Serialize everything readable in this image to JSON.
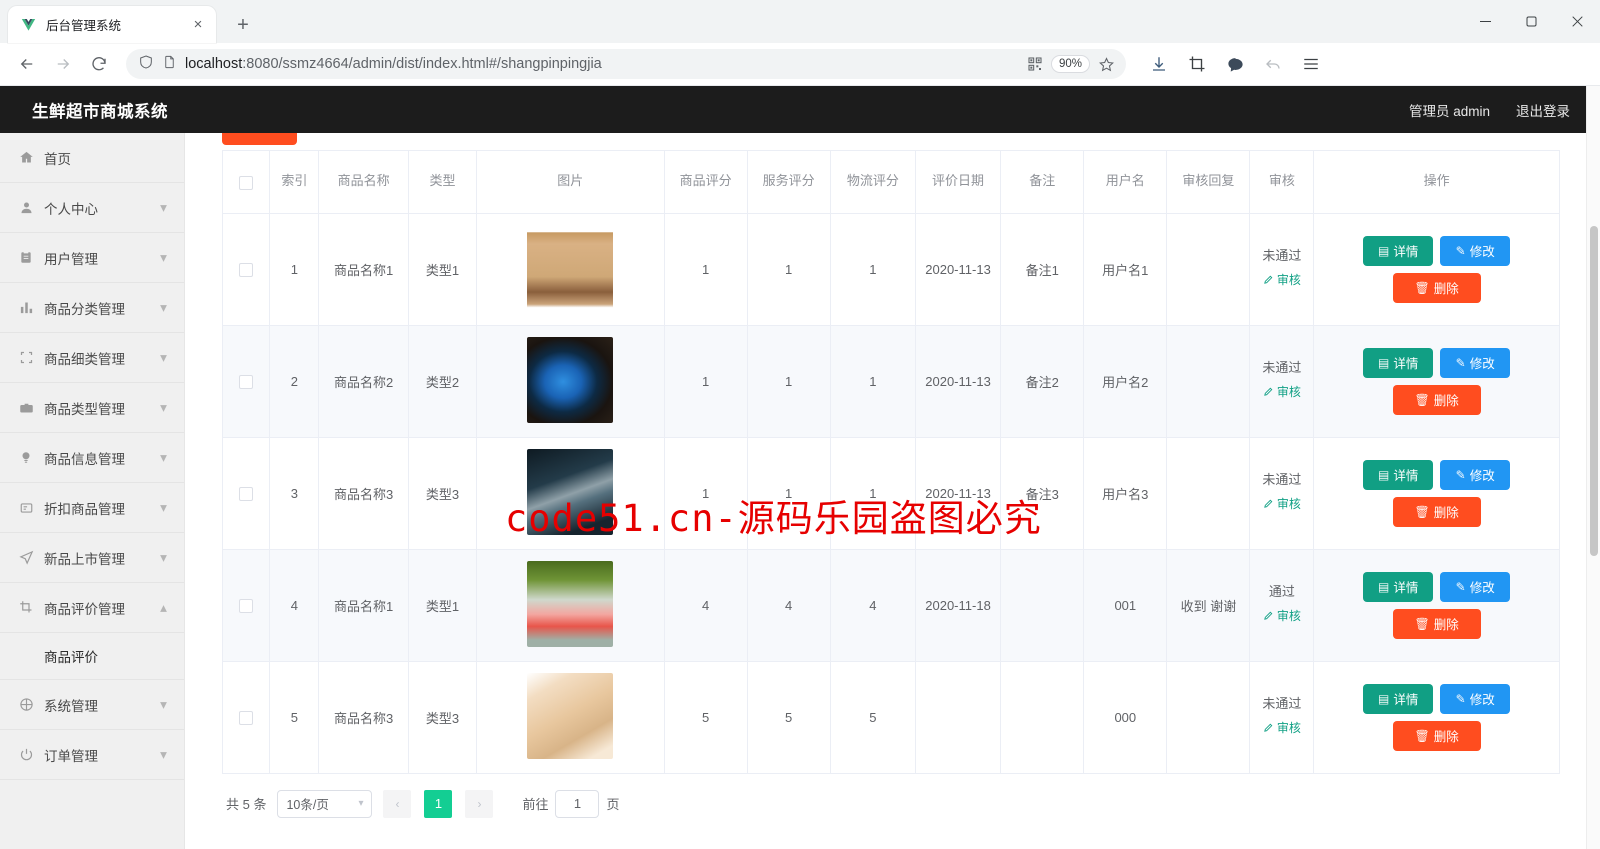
{
  "browser": {
    "tab": {
      "title": "后台管理系统",
      "favicon": "vue-logo-icon",
      "close": "×"
    },
    "new_tab": "+",
    "window_controls": {
      "minimize": "—",
      "maximize": "▢",
      "close": "✕"
    },
    "nav": {
      "back": "←",
      "forward": "→",
      "reload": "⟳"
    },
    "omnibox": {
      "shield_icon": "shield-icon",
      "page_icon": "page-icon",
      "url_host": "localhost",
      "url_rest": ":8080/ssmz4664/admin/dist/index.html#/shangpinpingjia",
      "qr_icon": "qr-code-icon",
      "zoom_level": "90%",
      "star_icon": "star-icon"
    },
    "toolbar_icons": [
      "download-icon",
      "screenshot-icon",
      "comment-icon",
      "undo-icon",
      "menu-icon"
    ]
  },
  "app": {
    "title": "生鲜超市商城系统",
    "user_label": "管理员 admin",
    "logout_label": "退出登录"
  },
  "sidebar": {
    "items": [
      {
        "label": "首页",
        "icon": "home-icon",
        "arrow": ""
      },
      {
        "label": "个人中心",
        "icon": "user-icon",
        "arrow": "▾"
      },
      {
        "label": "用户管理",
        "icon": "clipboard-icon",
        "arrow": "▾"
      },
      {
        "label": "商品分类管理",
        "icon": "bar-chart-icon",
        "arrow": "▾"
      },
      {
        "label": "商品细类管理",
        "icon": "crop-icon",
        "arrow": "▾"
      },
      {
        "label": "商品类型管理",
        "icon": "briefcase-icon",
        "arrow": "▾"
      },
      {
        "label": "商品信息管理",
        "icon": "bulb-icon",
        "arrow": "▾"
      },
      {
        "label": "折扣商品管理",
        "icon": "message-icon",
        "arrow": "▾"
      },
      {
        "label": "新品上市管理",
        "icon": "send-icon",
        "arrow": "▾"
      },
      {
        "label": "商品评价管理",
        "icon": "scissors-icon",
        "arrow": "▴"
      }
    ],
    "sub_item": {
      "label": "商品评价",
      "parent": "商品评价管理"
    },
    "items_after": [
      {
        "label": "系统管理",
        "icon": "compass-icon",
        "arrow": "▾"
      },
      {
        "label": "订单管理",
        "icon": "power-icon",
        "arrow": "▾"
      }
    ]
  },
  "table": {
    "headers": [
      "",
      "索引",
      "商品名称",
      "类型",
      "图片",
      "商品评分",
      "服务评分",
      "物流评分",
      "评价日期",
      "备注",
      "用户名",
      "审核回复",
      "审核",
      "操作"
    ],
    "rows": [
      {
        "index": "1",
        "name": "商品名称1",
        "type": "类型1",
        "image": "gift-box-photo",
        "product_score": "1",
        "service_score": "1",
        "logistics_score": "1",
        "date": "2020-11-13",
        "remark": "备注1",
        "username": "用户名1",
        "audit_reply": "",
        "audit_status": "未通过",
        "audit_link": "审核"
      },
      {
        "index": "2",
        "name": "商品名称2",
        "type": "类型2",
        "image": "blue-fish-photo",
        "product_score": "1",
        "service_score": "1",
        "logistics_score": "1",
        "date": "2020-11-13",
        "remark": "备注2",
        "username": "用户名2",
        "audit_reply": "",
        "audit_status": "未通过",
        "audit_link": "审核"
      },
      {
        "index": "3",
        "name": "商品名称3",
        "type": "类型3",
        "image": "grey-fish-photo",
        "product_score": "1",
        "service_score": "1",
        "logistics_score": "1",
        "date": "2020-11-13",
        "remark": "备注3",
        "username": "用户名3",
        "audit_reply": "",
        "audit_status": "未通过",
        "audit_link": "审核"
      },
      {
        "index": "4",
        "name": "商品名称1",
        "type": "类型1",
        "image": "watermelon-drink-photo",
        "product_score": "4",
        "service_score": "4",
        "logistics_score": "4",
        "date": "2020-11-18",
        "remark": "",
        "username": "001",
        "audit_reply": "收到 谢谢",
        "audit_status": "通过",
        "audit_link": "审核"
      },
      {
        "index": "5",
        "name": "商品名称3",
        "type": "类型3",
        "image": "egg-carton-photo",
        "product_score": "5",
        "service_score": "5",
        "logistics_score": "5",
        "date": "",
        "remark": "",
        "username": "000",
        "audit_reply": "",
        "audit_status": "未通过",
        "audit_link": "审核"
      }
    ],
    "actions": {
      "detail": "详情",
      "edit": "修改",
      "delete": "删除"
    }
  },
  "pagination": {
    "total_text": "共 5 条",
    "page_size": "10条/页",
    "prev": "‹",
    "next": "›",
    "current_page": "1",
    "jump_prefix": "前往",
    "jump_value": "1",
    "jump_suffix": "页"
  },
  "watermark": {
    "text": "code51.cn-源码乐园盗图必究",
    "color": "#e60000"
  },
  "colors": {
    "header_bg": "#1c1c1c",
    "sidebar_bg": "#f0f0f0",
    "detail_btn": "#119f84",
    "edit_btn": "#2196f3",
    "delete_btn": "#ff4d1f",
    "pager_active": "#13ce93",
    "audit_link": "#13a186"
  }
}
